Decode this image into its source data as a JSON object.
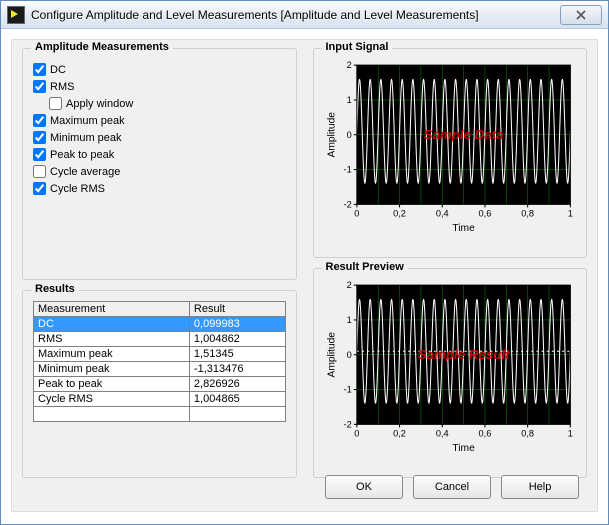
{
  "window": {
    "title": "Configure Amplitude and Level Measurements [Amplitude and Level Measurements]"
  },
  "amplitude_group": {
    "legend": "Amplitude Measurements",
    "items": [
      {
        "label": "DC",
        "checked": true
      },
      {
        "label": "RMS",
        "checked": true
      },
      {
        "label": "Apply window",
        "checked": false,
        "indent": true
      },
      {
        "label": "Maximum peak",
        "checked": true
      },
      {
        "label": "Minimum peak",
        "checked": true
      },
      {
        "label": "Peak to peak",
        "checked": true
      },
      {
        "label": "Cycle average",
        "checked": false
      },
      {
        "label": "Cycle RMS",
        "checked": true
      }
    ]
  },
  "results_group": {
    "legend": "Results",
    "columns": [
      "Measurement",
      "Result"
    ],
    "rows": [
      {
        "m": "DC",
        "r": "0,099983",
        "sel": true
      },
      {
        "m": "RMS",
        "r": "1,004862"
      },
      {
        "m": "Maximum peak",
        "r": "1,51345"
      },
      {
        "m": "Minimum peak",
        "r": "-1,313476"
      },
      {
        "m": "Peak to peak",
        "r": "2,826926"
      },
      {
        "m": "Cycle RMS",
        "r": "1,004865"
      }
    ]
  },
  "input_signal": {
    "legend": "Input Signal",
    "overlay": "Sample Data"
  },
  "result_preview": {
    "legend": "Result Preview",
    "overlay": "Sample Result"
  },
  "buttons": {
    "ok": "OK",
    "cancel": "Cancel",
    "help": "Help"
  },
  "chart_data": [
    {
      "type": "line",
      "title": "Input Signal",
      "xlabel": "Time",
      "ylabel": "Amplitude",
      "xlim": [
        0,
        1
      ],
      "ylim": [
        -2,
        2
      ],
      "xticks": [
        0,
        0.2,
        0.4,
        0.6,
        0.8,
        1
      ],
      "xtick_labels": [
        "0",
        "0,2",
        "0,4",
        "0,6",
        "0,8",
        "1"
      ],
      "yticks": [
        -2,
        -1,
        0,
        1,
        2
      ],
      "overlay_text": "Sample Data",
      "overlay_color": "#d00000",
      "series": [
        {
          "name": "signal",
          "freq_hz": 20,
          "amplitude": 1.5,
          "offset": 0.1,
          "color": "#ffffff"
        }
      ],
      "grid_color": "#0f6b0f",
      "bg": "#000000"
    },
    {
      "type": "line",
      "title": "Result Preview",
      "xlabel": "Time",
      "ylabel": "Amplitude",
      "xlim": [
        0,
        1
      ],
      "ylim": [
        -2,
        2
      ],
      "xticks": [
        0,
        0.2,
        0.4,
        0.6,
        0.8,
        1
      ],
      "xtick_labels": [
        "0",
        "0,2",
        "0,4",
        "0,6",
        "0,8",
        "1"
      ],
      "yticks": [
        -2,
        -1,
        0,
        1,
        2
      ],
      "overlay_text": "Sample Result",
      "overlay_color": "#d00000",
      "series": [
        {
          "name": "signal",
          "freq_hz": 20,
          "amplitude": 1.5,
          "offset": 0.1,
          "color": "#ffffff"
        },
        {
          "name": "dc",
          "style": "dotted",
          "y_const": 0.1,
          "color": "#ffffff"
        }
      ],
      "grid_color": "#0f6b0f",
      "bg": "#000000"
    }
  ]
}
